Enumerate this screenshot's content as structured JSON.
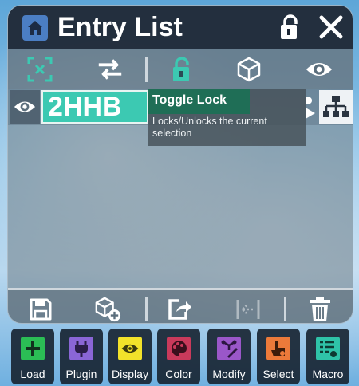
{
  "window": {
    "title": "Entry List",
    "icons": {
      "home": "home-icon",
      "lock": "unlock-icon",
      "close": "close-icon"
    }
  },
  "toolbar": {
    "items": [
      {
        "name": "deselect",
        "icon": "deselect-icon"
      },
      {
        "name": "swap",
        "icon": "swap-arrows-icon"
      },
      {
        "name": "lock",
        "icon": "unlock-icon"
      },
      {
        "name": "box",
        "icon": "cube-icon"
      },
      {
        "name": "visibility",
        "icon": "eye-icon"
      }
    ]
  },
  "entries": [
    {
      "name": "2HHB",
      "visible": true
    }
  ],
  "tooltip": {
    "title": "Toggle Lock",
    "description": "Locks/Unlocks the current selection"
  },
  "bottom_bar": {
    "items": [
      {
        "name": "save",
        "icon": "save-icon"
      },
      {
        "name": "add-object",
        "icon": "add-cube-icon"
      },
      {
        "name": "export",
        "icon": "export-icon"
      },
      {
        "name": "collapse",
        "icon": "collapse-icon"
      },
      {
        "name": "delete",
        "icon": "trash-icon"
      }
    ]
  },
  "dock": {
    "load": "Load",
    "plugin": "Plugin",
    "display": "Display",
    "color": "Color",
    "modify": "Modify",
    "select": "Select",
    "macro": "Macro"
  },
  "colors": {
    "accent_teal": "#3cc9b2",
    "titlebar": "#1c2634",
    "load": "#2bbd55",
    "plugin": "#8a66d6",
    "display": "#f2e22a",
    "color": "#c93a5b",
    "modify": "#9a57c9",
    "select": "#ec7a3a",
    "macro": "#2fc3a8"
  }
}
